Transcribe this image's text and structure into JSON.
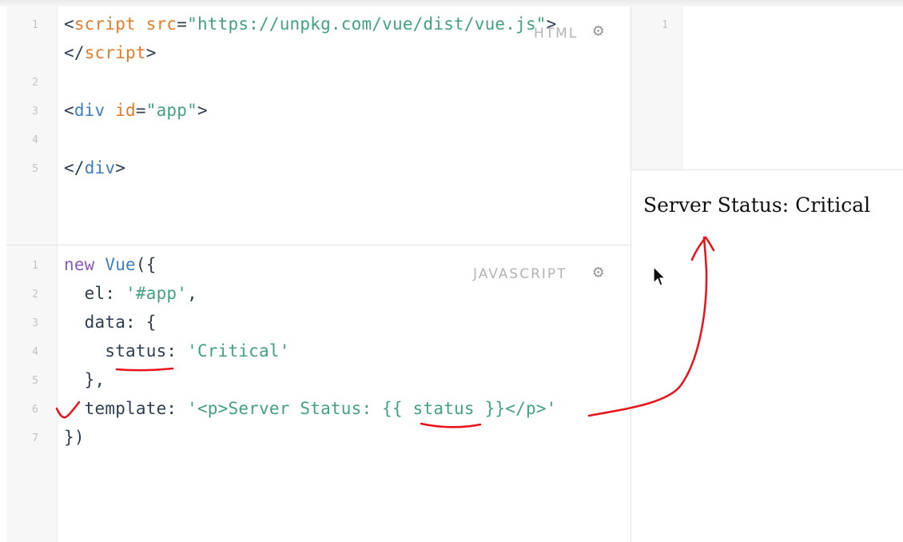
{
  "html_panel": {
    "label": "HTML",
    "lines": [
      {
        "num": "1",
        "segments": [
          {
            "t": "<",
            "c": "tok-tag"
          },
          {
            "t": "script",
            "c": "tok-attr"
          },
          {
            "t": " ",
            "c": "tok-tag"
          },
          {
            "t": "src",
            "c": "tok-attr"
          },
          {
            "t": "=",
            "c": "tok-tag"
          },
          {
            "t": "\"https://unpkg.com/vue/dist/vue.js\"",
            "c": "tok-str"
          },
          {
            "t": ">",
            "c": "tok-tag"
          }
        ]
      },
      {
        "num": "",
        "segments": [
          {
            "t": "</",
            "c": "tok-tag"
          },
          {
            "t": "script",
            "c": "tok-attr"
          },
          {
            "t": ">",
            "c": "tok-tag"
          }
        ]
      },
      {
        "num": "2",
        "segments": []
      },
      {
        "num": "3",
        "segments": [
          {
            "t": "<",
            "c": "tok-tag"
          },
          {
            "t": "div",
            "c": "tok-fn"
          },
          {
            "t": " ",
            "c": "tok-tag"
          },
          {
            "t": "id",
            "c": "tok-attr"
          },
          {
            "t": "=",
            "c": "tok-tag"
          },
          {
            "t": "\"app\"",
            "c": "tok-str"
          },
          {
            "t": ">",
            "c": "tok-tag"
          }
        ]
      },
      {
        "num": "4",
        "segments": []
      },
      {
        "num": "5",
        "segments": [
          {
            "t": "</",
            "c": "tok-tag"
          },
          {
            "t": "div",
            "c": "tok-fn"
          },
          {
            "t": ">",
            "c": "tok-tag"
          }
        ]
      }
    ]
  },
  "js_panel": {
    "label": "JAVASCRIPT",
    "lines": [
      {
        "num": "1",
        "segments": [
          {
            "t": "new",
            "c": "tok-kw"
          },
          {
            "t": " ",
            "c": "tok-tag"
          },
          {
            "t": "Vue",
            "c": "tok-fn"
          },
          {
            "t": "({",
            "c": "tok-tag"
          }
        ]
      },
      {
        "num": "2",
        "segments": [
          {
            "t": "  el: ",
            "c": "tok-tag"
          },
          {
            "t": "'#app'",
            "c": "tok-str"
          },
          {
            "t": ",",
            "c": "tok-tag"
          }
        ]
      },
      {
        "num": "3",
        "segments": [
          {
            "t": "  data: {",
            "c": "tok-tag"
          }
        ]
      },
      {
        "num": "4",
        "segments": [
          {
            "t": "    status: ",
            "c": "tok-tag"
          },
          {
            "t": "'Critical'",
            "c": "tok-str"
          }
        ]
      },
      {
        "num": "5",
        "segments": [
          {
            "t": "  },",
            "c": "tok-tag"
          }
        ]
      },
      {
        "num": "6",
        "segments": [
          {
            "t": "  template: ",
            "c": "tok-tag"
          },
          {
            "t": "'<p>Server Status: {{ status }}</p>'",
            "c": "tok-str"
          }
        ]
      },
      {
        "num": "7",
        "segments": [
          {
            "t": "})",
            "c": "tok-tag"
          }
        ]
      }
    ]
  },
  "css_panel": {
    "lines": [
      {
        "num": "1"
      }
    ]
  },
  "output": {
    "text": "Server Status: Critical"
  },
  "icons": {
    "gear": "gear-icon",
    "cursor": "mouse-pointer-icon"
  },
  "colors": {
    "annotation": "#e8131a",
    "string": "#42a184",
    "attribute": "#e07b2a",
    "keyword": "#8a5bbf",
    "function": "#3d7fc4"
  }
}
